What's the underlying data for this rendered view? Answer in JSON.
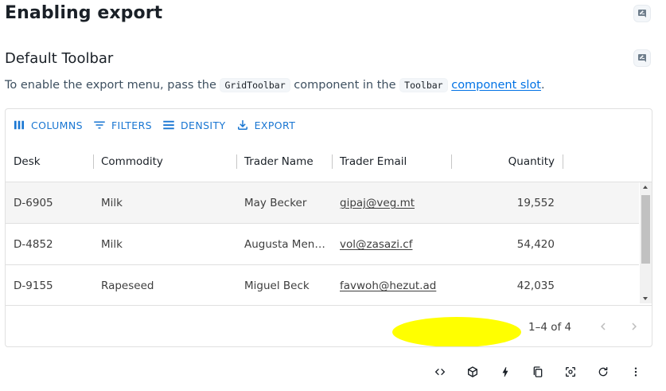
{
  "page": {
    "title": "Enabling export",
    "subtitle": "Default Toolbar",
    "desc_before": "To enable the export menu, pass the ",
    "desc_code1": "GridToolbar",
    "desc_mid": " component in the ",
    "desc_code2": "Toolbar",
    "desc_link": "component slot",
    "desc_after": "."
  },
  "toolbar": {
    "columns": "COLUMNS",
    "filters": "FILTERS",
    "density": "DENSITY",
    "export": "EXPORT"
  },
  "columns": [
    "Desk",
    "Commodity",
    "Trader Name",
    "Trader Email",
    "Quantity"
  ],
  "rows": [
    {
      "desk": "D-6905",
      "commodity": "Milk",
      "trader": "May Becker",
      "email": "gipaj@veg.mt",
      "quantity": "19,552"
    },
    {
      "desk": "D-4852",
      "commodity": "Milk",
      "trader": "Augusta Men…",
      "email": "vol@zasazi.cf",
      "quantity": "54,420"
    },
    {
      "desk": "D-9155",
      "commodity": "Rapeseed",
      "trader": "Miguel Beck",
      "email": "favwoh@hezut.ad",
      "quantity": "42,035"
    }
  ],
  "footer": {
    "range": "1–4 of 4"
  },
  "icons": {
    "columns": "view-column-icon",
    "filters": "filter-list-icon",
    "density": "density-icon",
    "export": "file-download-icon",
    "prev": "chevron-left-icon",
    "next": "chevron-right-icon"
  },
  "colors": {
    "accent": "#1976d2",
    "link": "#0072e5",
    "highlight": "#ffff00"
  }
}
